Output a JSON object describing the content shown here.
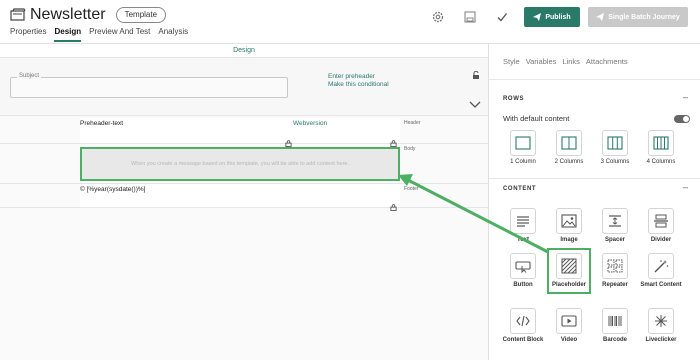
{
  "header": {
    "title": "Newsletter",
    "badge": "Template",
    "tabs": [
      {
        "label": "Properties"
      },
      {
        "label": "Design"
      },
      {
        "label": "Preview And Test"
      },
      {
        "label": "Analysis"
      }
    ],
    "publish_label": "Publish",
    "batch_label": "Single Batch Journey"
  },
  "canvas": {
    "design_label": "Design",
    "subject_legend": "Subject",
    "preheader_line1": "Enter preheader",
    "preheader_line2": "Make this conditional",
    "header_row": {
      "left": "Preheader-text",
      "link": "Webversion",
      "label": "Header"
    },
    "body_row": {
      "placeholder": "When you create a message based on this template, you will be able to add content here.",
      "label": "Body"
    },
    "footer_row": {
      "text": "© [%year(sysdate())%]",
      "label": "Footer"
    }
  },
  "panel": {
    "tabs": [
      {
        "label": "Style"
      },
      {
        "label": "Variables"
      },
      {
        "label": "Links"
      },
      {
        "label": "Attachments"
      }
    ],
    "rows_title": "ROWS",
    "default_content": "With default content",
    "rows": [
      {
        "label": "1 Column",
        "icon": "one-column-icon"
      },
      {
        "label": "2 Columns",
        "icon": "two-columns-icon"
      },
      {
        "label": "3 Columns",
        "icon": "three-columns-icon"
      },
      {
        "label": "4 Columns",
        "icon": "four-columns-icon"
      }
    ],
    "content_title": "CONTENT",
    "content": [
      {
        "label": "Text",
        "icon": "text-icon"
      },
      {
        "label": "Image",
        "icon": "image-icon"
      },
      {
        "label": "Spacer",
        "icon": "spacer-icon"
      },
      {
        "label": "Divider",
        "icon": "divider-icon"
      },
      {
        "label": "Button",
        "icon": "button-icon"
      },
      {
        "label": "Placeholder",
        "icon": "placeholder-icon"
      },
      {
        "label": "Repeater",
        "icon": "repeater-icon"
      },
      {
        "label": "Smart Content",
        "icon": "smart-content-icon"
      },
      {
        "label": "Content Block",
        "icon": "content-block-icon"
      },
      {
        "label": "Video",
        "icon": "video-icon"
      },
      {
        "label": "Barcode",
        "icon": "barcode-icon"
      },
      {
        "label": "Liveclicker",
        "icon": "liveclicker-icon"
      }
    ]
  },
  "colors": {
    "accent": "#2a7a6a",
    "highlight": "#4caf62",
    "disabled": "#c9c9c9"
  }
}
